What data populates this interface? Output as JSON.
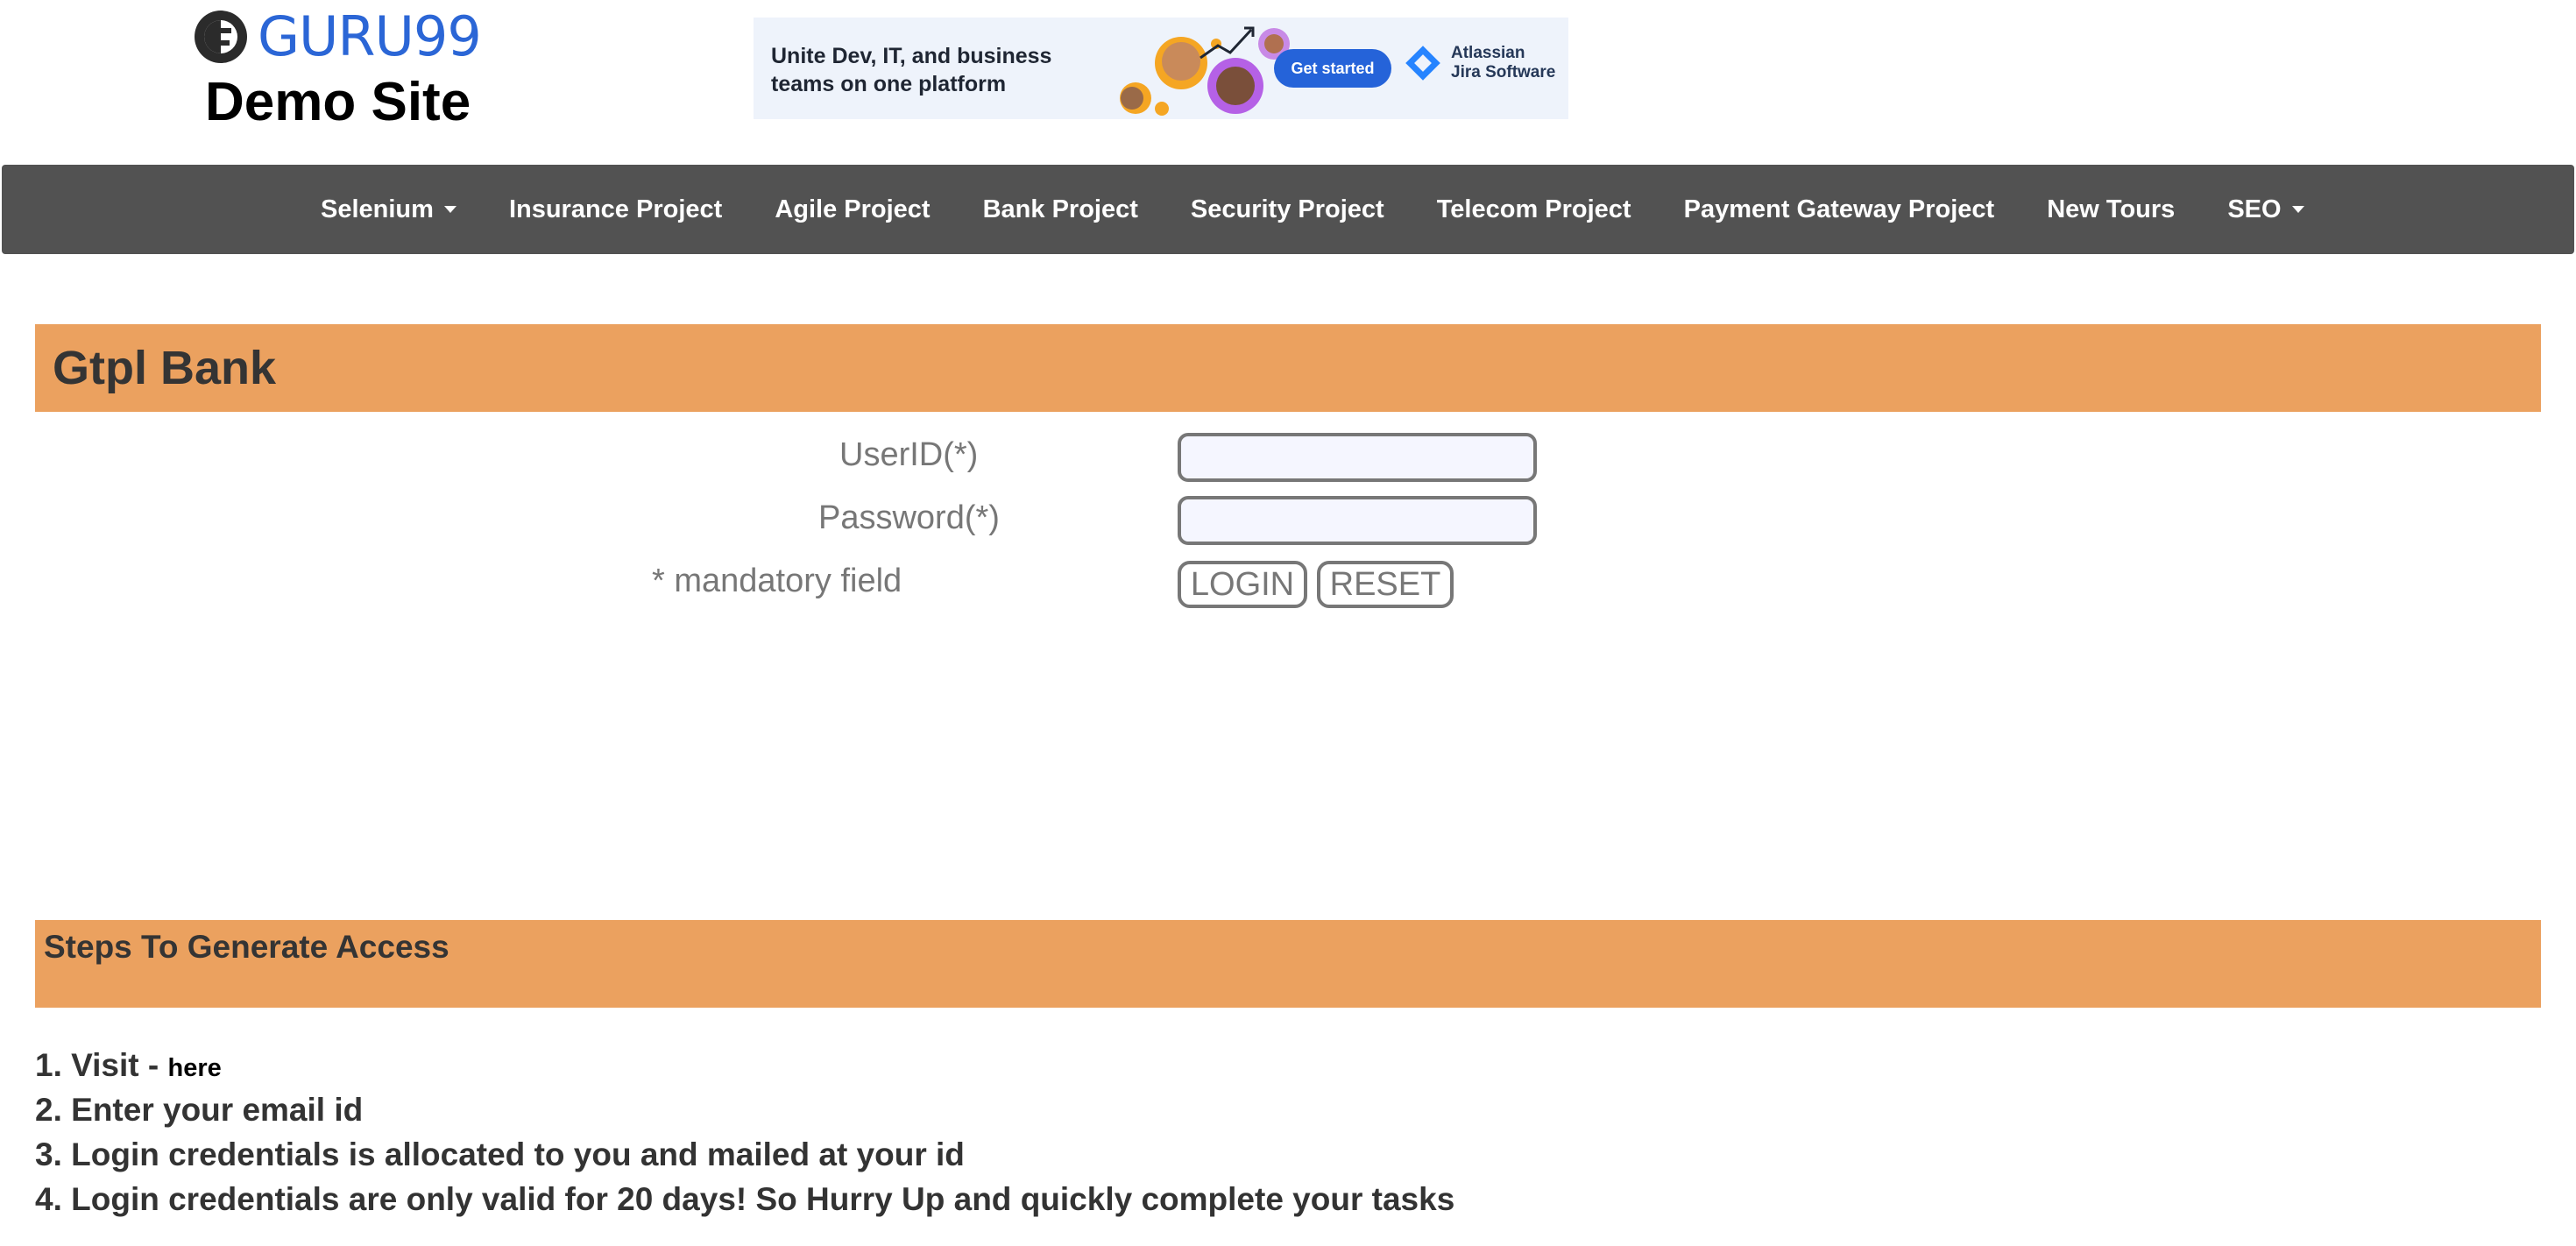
{
  "header": {
    "logo_text": "GURU99",
    "site_title": "Demo Site",
    "ad": {
      "headline": "Unite Dev, IT, and business teams on one platform",
      "cta_label": "Get started",
      "brand_line1": "Atlassian",
      "brand_line2": "Jira Software"
    }
  },
  "nav": {
    "items": [
      {
        "label": "Selenium",
        "dropdown": true
      },
      {
        "label": "Insurance Project"
      },
      {
        "label": "Agile Project"
      },
      {
        "label": "Bank Project"
      },
      {
        "label": "Security Project"
      },
      {
        "label": "Telecom Project"
      },
      {
        "label": "Payment Gateway Project"
      },
      {
        "label": "New Tours"
      },
      {
        "label": "SEO",
        "dropdown": true
      }
    ],
    "background": "#525252"
  },
  "main": {
    "title": "Gtpl Bank",
    "accent": "#eba15f",
    "form": {
      "userid_label": "UserID(*)",
      "userid_value": "",
      "password_label": "Password(*)",
      "password_value": "",
      "mandatory_note": "* mandatory field",
      "login_label": "LOGIN",
      "reset_label": "RESET"
    }
  },
  "steps": {
    "title": "Steps To Generate Access",
    "items": [
      {
        "number": "1.",
        "text": "Visit - ",
        "link": "here"
      },
      {
        "number": "2.",
        "text": "Enter your email id"
      },
      {
        "number": "3.",
        "text": "Login credentials is allocated to you and mailed at your id"
      },
      {
        "number": "4.",
        "text": "Login credentials are only valid for 20 days! So Hurry Up and quickly complete your tasks"
      }
    ]
  }
}
